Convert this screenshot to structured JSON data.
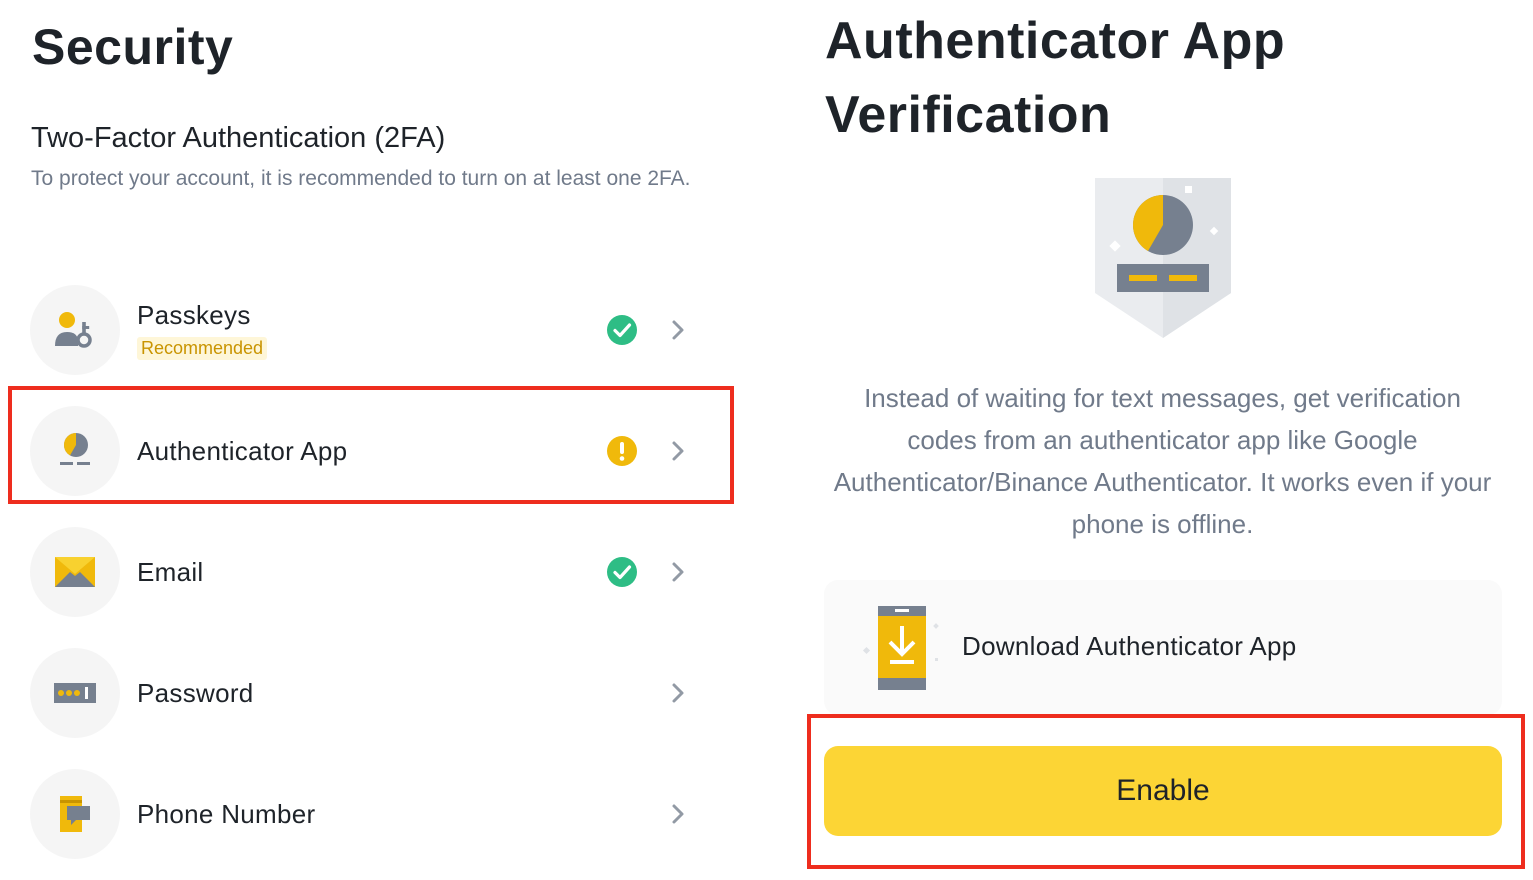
{
  "security": {
    "title": "Security",
    "section_title": "Two-Factor Authentication (2FA)",
    "section_description": "To protect your account, it is recommended to turn on at least one 2FA.",
    "items": [
      {
        "label": "Passkeys",
        "badge": "Recommended",
        "icon": "passkey-icon",
        "status": "enabled"
      },
      {
        "label": "Authenticator App",
        "icon": "authenticator-icon",
        "status": "warning"
      },
      {
        "label": "Email",
        "icon": "email-icon",
        "status": "enabled"
      },
      {
        "label": "Password",
        "icon": "password-icon",
        "status": "none"
      },
      {
        "label": "Phone Number",
        "icon": "phone-message-icon",
        "status": "none"
      }
    ]
  },
  "verification": {
    "title": "Authenticator App Verification",
    "description": "Instead of waiting for text messages, get verification codes from an authenticator app like Google Authenticator/Binance Authenticator. It works even if your phone is offline.",
    "download_label": "Download Authenticator App",
    "enable_label": "Enable"
  },
  "colors": {
    "brand_yellow": "#fcd535",
    "icon_yellow": "#f0b90b",
    "success_green": "#2ebd85",
    "highlight_red": "#ee2d1e",
    "text_primary": "#1e2329",
    "text_secondary": "#707a8a"
  }
}
